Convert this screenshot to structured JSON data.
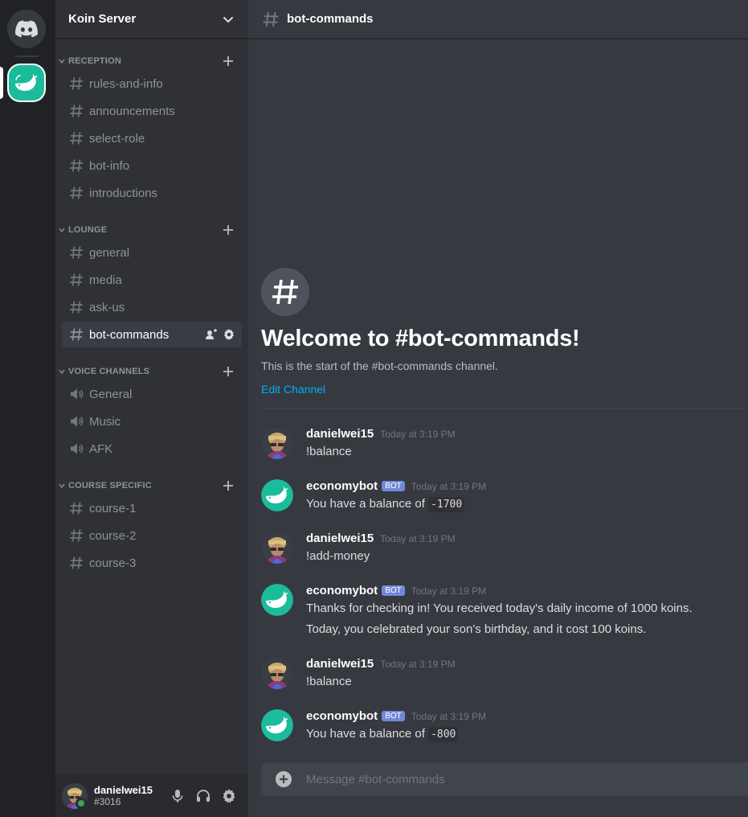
{
  "colors": {
    "accent_blurple": "#7289da",
    "server_teal": "#1abc9c",
    "link": "#00b0f4",
    "online": "#3ba55d"
  },
  "rail": {
    "home_icon": "discord-logo-icon",
    "servers": [
      {
        "icon": "whale-icon",
        "selected": true
      }
    ]
  },
  "server": {
    "name": "Koin Server"
  },
  "categories": [
    {
      "name": "RECEPTION",
      "channels": [
        {
          "label": "rules-and-info",
          "type": "text"
        },
        {
          "label": "announcements",
          "type": "text"
        },
        {
          "label": "select-role",
          "type": "text"
        },
        {
          "label": "bot-info",
          "type": "text"
        },
        {
          "label": "introductions",
          "type": "text"
        }
      ]
    },
    {
      "name": "LOUNGE",
      "channels": [
        {
          "label": "general",
          "type": "text"
        },
        {
          "label": "media",
          "type": "text"
        },
        {
          "label": "ask-us",
          "type": "text"
        },
        {
          "label": "bot-commands",
          "type": "text",
          "active": true
        }
      ]
    },
    {
      "name": "VOICE CHANNELS",
      "channels": [
        {
          "label": "General",
          "type": "voice"
        },
        {
          "label": "Music",
          "type": "voice"
        },
        {
          "label": "AFK",
          "type": "voice"
        }
      ]
    },
    {
      "name": "COURSE SPECIFIC",
      "channels": [
        {
          "label": "course-1",
          "type": "text"
        },
        {
          "label": "course-2",
          "type": "text"
        },
        {
          "label": "course-3",
          "type": "text"
        }
      ]
    }
  ],
  "user_panel": {
    "username": "danielwei15",
    "tag": "#3016",
    "status": "online"
  },
  "channel": {
    "name": "bot-commands"
  },
  "welcome": {
    "title": "Welcome to #bot-commands!",
    "subtitle": "This is the start of the #bot-commands channel.",
    "edit_link": "Edit Channel"
  },
  "messages": [
    {
      "author": "danielwei15",
      "bot": false,
      "time": "Today at 3:19 PM",
      "lines": [
        {
          "text": "!balance"
        }
      ]
    },
    {
      "author": "economybot",
      "bot": true,
      "bot_tag": "BOT",
      "time": "Today at 3:19 PM",
      "lines": [
        {
          "text": "You have a balance of ",
          "code": "-1700"
        }
      ]
    },
    {
      "author": "danielwei15",
      "bot": false,
      "time": "Today at 3:19 PM",
      "lines": [
        {
          "text": "!add-money"
        }
      ]
    },
    {
      "author": "economybot",
      "bot": true,
      "bot_tag": "BOT",
      "time": "Today at 3:19 PM",
      "lines": [
        {
          "text": "Thanks for checking in! You received today's daily income of 1000 koins."
        },
        {
          "text": "Today, you celebrated your son's birthday, and it cost 100 koins."
        }
      ]
    },
    {
      "author": "danielwei15",
      "bot": false,
      "time": "Today at 3:19 PM",
      "lines": [
        {
          "text": "!balance"
        }
      ]
    },
    {
      "author": "economybot",
      "bot": true,
      "bot_tag": "BOT",
      "time": "Today at 3:19 PM",
      "lines": [
        {
          "text": "You have a balance of ",
          "code": "-800"
        }
      ]
    }
  ],
  "composer": {
    "placeholder": "Message #bot-commands"
  }
}
